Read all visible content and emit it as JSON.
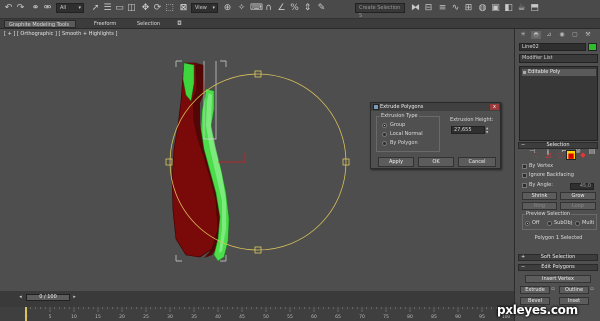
{
  "toolbar": {
    "selection_filter": "All",
    "ref_coord": "View",
    "named_selection": "Create Selection S",
    "icons": [
      "undo-icon",
      "redo-icon",
      "link-icon",
      "unlink-icon",
      "bind-spacewarp-icon",
      "select-icon",
      "select-by-name-icon",
      "rect-selection-icon",
      "window-crossing-icon",
      "move-icon",
      "rotate-icon",
      "scale-icon",
      "pivot-icon",
      "snap-icon",
      "angle-snap-icon",
      "percent-snap-icon",
      "spinner-snap-icon",
      "mirror-icon",
      "align-icon",
      "layer-icon",
      "curve-editor-icon",
      "schematic-icon",
      "material-editor-icon",
      "render-setup-icon",
      "render-frame-icon",
      "render-icon"
    ]
  },
  "ribbon": {
    "tabs": [
      {
        "label": "Graphite Modeling Tools",
        "active": true
      },
      {
        "label": "Freeform",
        "active": false
      },
      {
        "label": "Selection",
        "active": false
      }
    ]
  },
  "viewport": {
    "label": "[ + ] [ Orthographic ] [ Smooth + Highlights ]"
  },
  "dialog": {
    "title": "Extrude Polygons",
    "group_title": "Extrusion Type",
    "options": [
      {
        "label": "Group",
        "selected": true
      },
      {
        "label": "Local Normal",
        "selected": false
      },
      {
        "label": "By Polygon",
        "selected": false
      }
    ],
    "height_label": "Extrusion Height:",
    "height_value": "27,655",
    "buttons": {
      "apply": "Apply",
      "ok": "OK",
      "cancel": "Cancel"
    },
    "close": "x"
  },
  "command_panel": {
    "object_name": "Line02",
    "object_color": "#2dbd2d",
    "modifier_list": "Modifier List",
    "stack_item": "Editable Poly",
    "selection_rollout": "Selection",
    "by_vertex": "By Vertex",
    "ignore_backfacing": "Ignore Backfacing",
    "by_angle": "By Angle:",
    "angle_value": "45,0",
    "shrink": "Shrink",
    "grow": "Grow",
    "ring": "Ring",
    "loop": "Loop",
    "preview_title": "Preview Selection",
    "preview_off": "Off",
    "preview_subobj": "SubObj",
    "preview_multi": "Multi",
    "status": "Polygon 1 Selected",
    "soft_selection": "Soft Selection",
    "edit_polygons": "Edit Polygons",
    "insert_vertex": "Insert Vertex",
    "extrude": "Extrude",
    "outline": "Outline",
    "bevel": "Bevel",
    "inset": "Inset"
  },
  "timeline": {
    "frame": "0 / 100",
    "ticks": [
      "0",
      "5",
      "10",
      "15",
      "20",
      "25",
      "30",
      "35",
      "40",
      "45",
      "50",
      "55",
      "60",
      "65",
      "70",
      "75",
      "80",
      "85",
      "90",
      "95",
      "100"
    ]
  },
  "watermark": "pxleyes.com"
}
